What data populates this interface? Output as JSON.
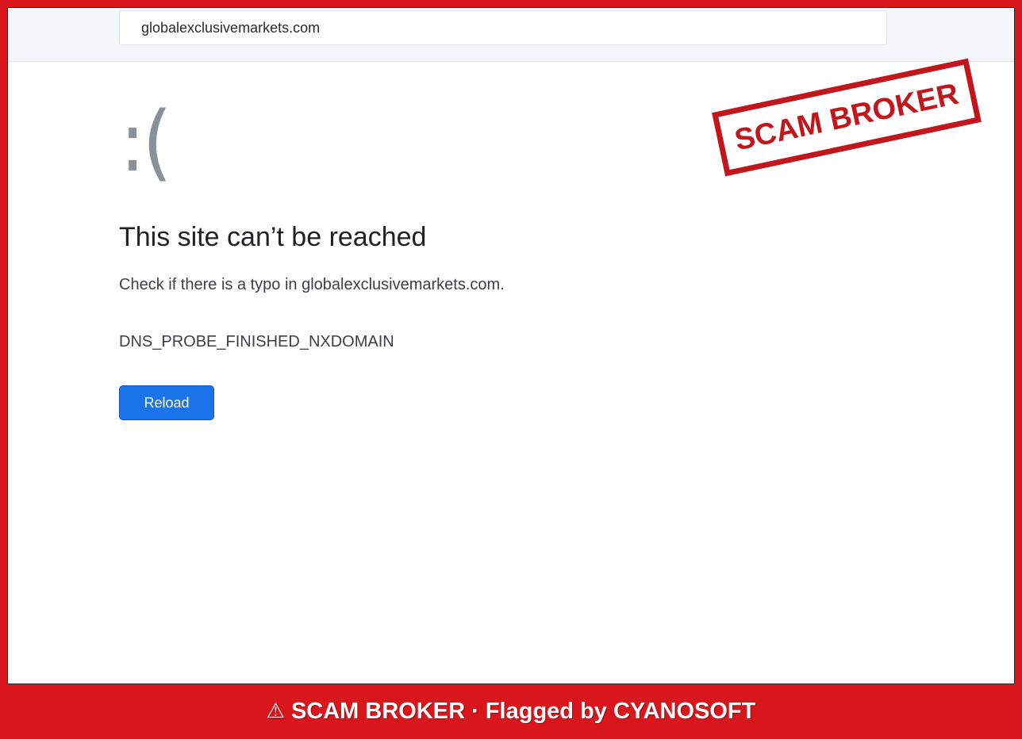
{
  "browser": {
    "address_bar": {
      "value": "globalexclusivemarkets.com"
    }
  },
  "error_page": {
    "icon": "sad-face",
    "face_text": ":(",
    "title": "This site can’t be reached",
    "detail": "Check if there is a typo in globalexclusivemarkets.com.",
    "error_code": "DNS_PROBE_FINISHED_NXDOMAIN",
    "reload_label": "Reload"
  },
  "overlay": {
    "stamp_text": "SCAM BROKER",
    "stamp_color": "#c0161c",
    "banner_icon": "⚠",
    "banner_text": "SCAM BROKER · Flagged by CYANOSOFT",
    "banner_color": "#d9161c"
  },
  "colors": {
    "reload_button": "#1a73e8",
    "face": "#8a9097"
  }
}
